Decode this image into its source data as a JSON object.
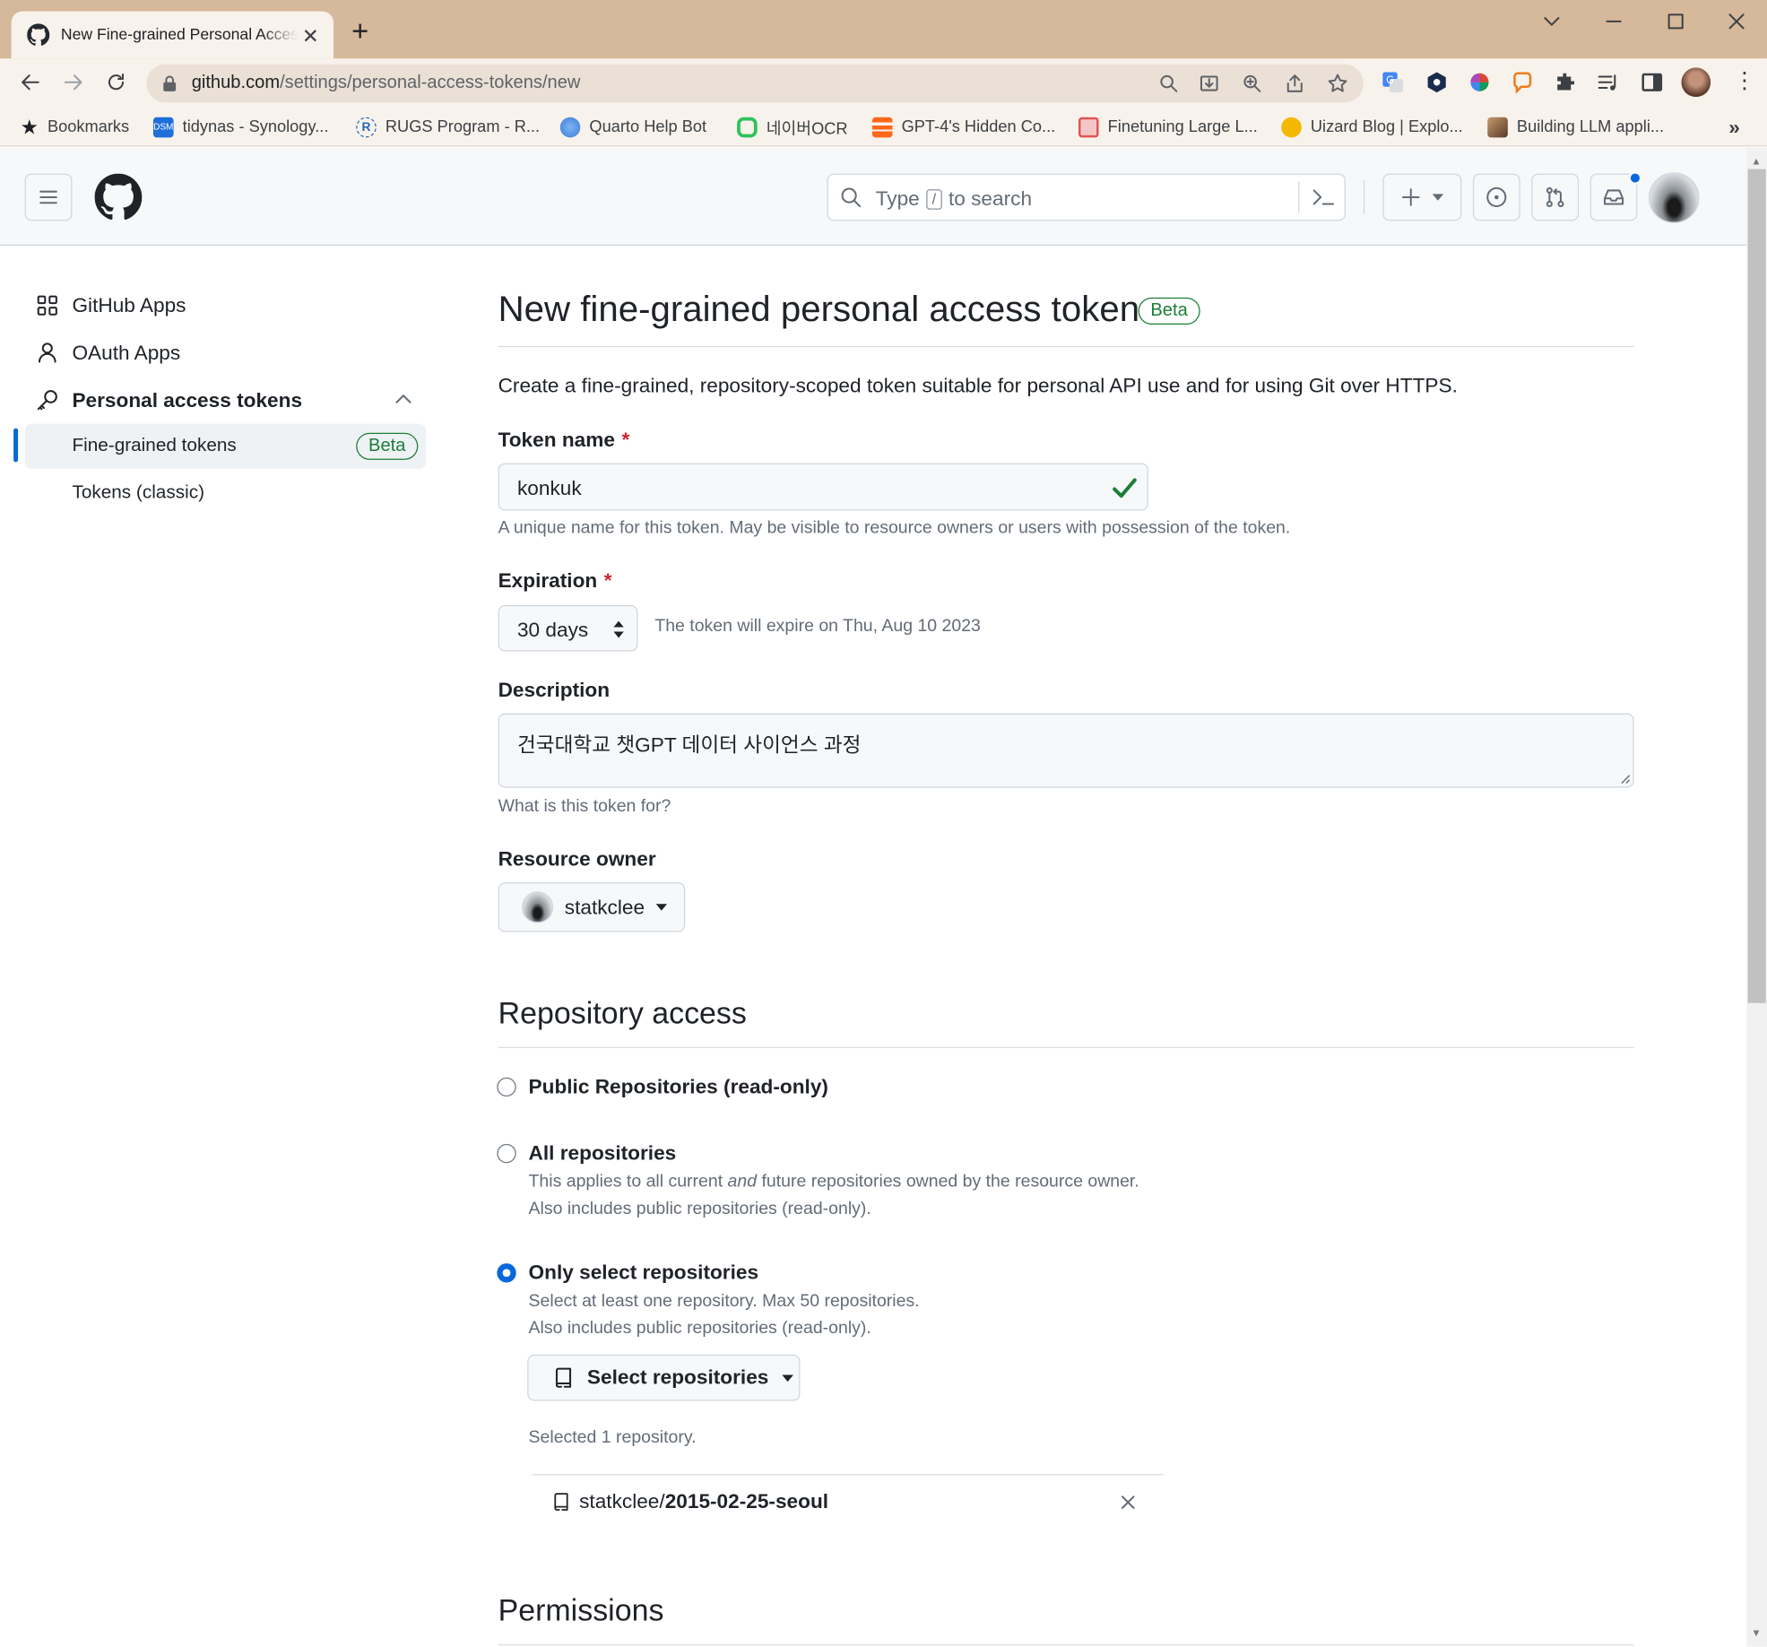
{
  "browser": {
    "tab_title": "New Fine-grained Personal Access Tokens",
    "new_tab_symbol": "+",
    "url_host": "github.com",
    "url_path": "/settings/personal-access-tokens/new",
    "bookmarks": [
      {
        "label": "Bookmarks",
        "icon": "star-icon"
      },
      {
        "label": "tidynas - Synology...",
        "icon": "dsm-icon",
        "color": "#1e6fd9"
      },
      {
        "label": "RUGS Program - R...",
        "icon": "r-icon",
        "color": "#2266b6"
      },
      {
        "label": "Quarto Help Bot",
        "icon": "globe-icon",
        "color": "#4a90e2"
      },
      {
        "label": "네이버OCR",
        "icon": "naver-clova-icon",
        "color": "#2fc25b"
      },
      {
        "label": "GPT-4's Hidden Co...",
        "icon": "substack-icon",
        "color": "#ff6719"
      },
      {
        "label": "Finetuning Large L...",
        "icon": "finetune-icon",
        "color": "#e05555"
      },
      {
        "label": "Uizard Blog | Explo...",
        "icon": "uizard-icon",
        "color": "#f5b800"
      },
      {
        "label": "Building LLM appli...",
        "icon": "blog-avatar-icon",
        "color": "#8a5a3a"
      }
    ],
    "more_bookmarks": "»"
  },
  "gh_header": {
    "search_placeholder_pre": "Type",
    "search_key": "/",
    "search_placeholder_post": "to search"
  },
  "sidebar": {
    "items": [
      {
        "label": "GitHub Apps",
        "icon": "apps-grid-icon"
      },
      {
        "label": "OAuth Apps",
        "icon": "person-icon"
      },
      {
        "label": "Personal access tokens",
        "icon": "key-icon"
      }
    ],
    "subitems": [
      {
        "label": "Fine-grained tokens",
        "badge": "Beta",
        "active": true
      },
      {
        "label": "Tokens (classic)",
        "active": false
      }
    ]
  },
  "main": {
    "title": "New fine-grained personal access token",
    "title_badge": "Beta",
    "intro": "Create a fine-grained, repository-scoped token suitable for personal API use and for using Git over HTTPS.",
    "token_name": {
      "label": "Token name",
      "required": "*",
      "value": "konkuk",
      "note": "A unique name for this token. May be visible to resource owners or users with possession of the token."
    },
    "expiration": {
      "label": "Expiration",
      "required": "*",
      "value": "30 days",
      "note": "The token will expire on Thu, Aug 10 2023"
    },
    "description": {
      "label": "Description",
      "value": "건국대학교 챗GPT 데이터 사이언스 과정",
      "note": "What is this token for?"
    },
    "resource_owner": {
      "label": "Resource owner",
      "value": "statkclee"
    },
    "repository_access": {
      "heading": "Repository access",
      "options": [
        {
          "label": "Public Repositories (read-only)",
          "selected": false
        },
        {
          "label": "All repositories",
          "selected": false,
          "desc_pre": "This applies to all current ",
          "desc_em": "and",
          "desc_post": " future repositories owned by the resource owner.",
          "desc2": "Also includes public repositories (read-only)."
        },
        {
          "label": "Only select repositories",
          "selected": true,
          "desc1": "Select at least one repository. Max 50 repositories.",
          "desc2": "Also includes public repositories (read-only)."
        }
      ],
      "select_button": "Select repositories",
      "selected_count": "Selected 1 repository.",
      "selected_repos": [
        {
          "owner": "statkclee/",
          "name": "2015-02-25-seoul"
        }
      ]
    },
    "permissions_heading": "Permissions"
  },
  "colors": {
    "accent": "#0969da",
    "success": "#1a7f37",
    "danger": "#d1242f"
  }
}
